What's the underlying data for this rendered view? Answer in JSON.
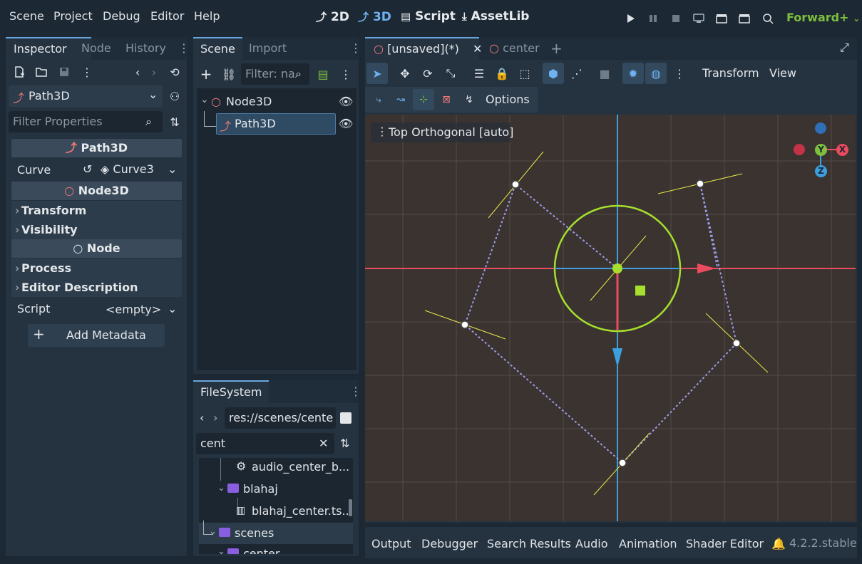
{
  "menu": {
    "items": [
      "Scene",
      "Project",
      "Debug",
      "Editor",
      "Help"
    ],
    "workspaces": [
      "2D",
      "3D",
      "Script",
      "AssetLib"
    ],
    "renderer": "Forward+"
  },
  "inspector": {
    "tabs": [
      "Inspector",
      "Node",
      "History"
    ],
    "node_select": "Path3D",
    "filter_placeholder": "Filter Properties",
    "section_path3d": "Path3D",
    "curve_label": "Curve",
    "curve_value": "Curve3",
    "section_node3d": "Node3D",
    "group_transform": "Transform",
    "group_visibility": "Visibility",
    "section_node": "Node",
    "group_process": "Process",
    "group_editor_desc": "Editor Description",
    "script_label": "Script",
    "script_value": "<empty>",
    "add_metadata": "Add Metadata"
  },
  "scene": {
    "tabs": [
      "Scene",
      "Import"
    ],
    "filter_placeholder": "Filter: na",
    "tree": [
      {
        "name": "Node3D"
      },
      {
        "name": "Path3D"
      }
    ]
  },
  "filesystem": {
    "tab": "FileSystem",
    "path": "res://scenes/cente",
    "search": "cent",
    "items": [
      {
        "label": "audio_center_b..."
      },
      {
        "label": "blahaj"
      },
      {
        "label": "blahaj_center.ts..."
      },
      {
        "label": "scenes"
      },
      {
        "label": "center"
      }
    ]
  },
  "editor": {
    "tabs": [
      "[unsaved](*)",
      "center"
    ],
    "menu_transform": "Transform",
    "menu_view": "View",
    "options": "Options",
    "viewport_label": "Top Orthogonal [auto]",
    "gizmo": {
      "y": "Y",
      "x": "X",
      "z": "Z"
    }
  },
  "bottom": {
    "tabs": [
      "Output",
      "Debugger",
      "Search Results",
      "Audio",
      "Animation",
      "Shader Editor"
    ],
    "version": "4.2.2.stable"
  },
  "colors": {
    "accent": "#6fb2f2",
    "x_axis": "#ea4b5f",
    "y_axis": "#a6e02c",
    "z_axis": "#3c9fe0",
    "curve": "#9a9ce8",
    "handle": "#e8e84a"
  }
}
